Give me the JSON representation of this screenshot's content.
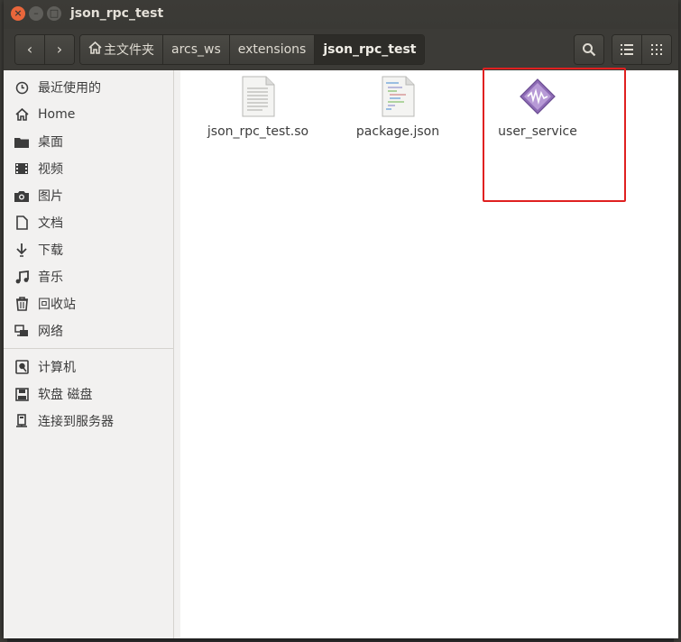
{
  "window": {
    "title": "json_rpc_test"
  },
  "toolbar": {
    "back_label": "‹",
    "forward_label": "›",
    "breadcrumbs": [
      {
        "label": "主文件夹"
      },
      {
        "label": "arcs_ws"
      },
      {
        "label": "extensions"
      },
      {
        "label": "json_rpc_test"
      }
    ]
  },
  "sidebar": {
    "items": [
      {
        "label": "最近使用的",
        "icon": "clock-icon"
      },
      {
        "label": "Home",
        "icon": "home-icon"
      },
      {
        "label": "桌面",
        "icon": "folder-icon"
      },
      {
        "label": "视频",
        "icon": "video-icon"
      },
      {
        "label": "图片",
        "icon": "camera-icon"
      },
      {
        "label": "文档",
        "icon": "document-icon"
      },
      {
        "label": "下载",
        "icon": "download-icon"
      },
      {
        "label": "音乐",
        "icon": "music-icon"
      },
      {
        "label": "回收站",
        "icon": "trash-icon"
      },
      {
        "label": "网络",
        "icon": "network-icon"
      }
    ],
    "devices": [
      {
        "label": "计算机",
        "icon": "computer-icon"
      },
      {
        "label": "软盘 磁盘",
        "icon": "floppy-icon"
      },
      {
        "label": "连接到服务器",
        "icon": "server-icon"
      }
    ]
  },
  "files": [
    {
      "name": "json_rpc_test.so",
      "icon": "text-file-icon"
    },
    {
      "name": "package.json",
      "icon": "json-file-icon"
    },
    {
      "name": "user_service",
      "icon": "executable-icon"
    }
  ],
  "colors": {
    "highlight": "#e02020",
    "close_button": "#e9663b"
  }
}
